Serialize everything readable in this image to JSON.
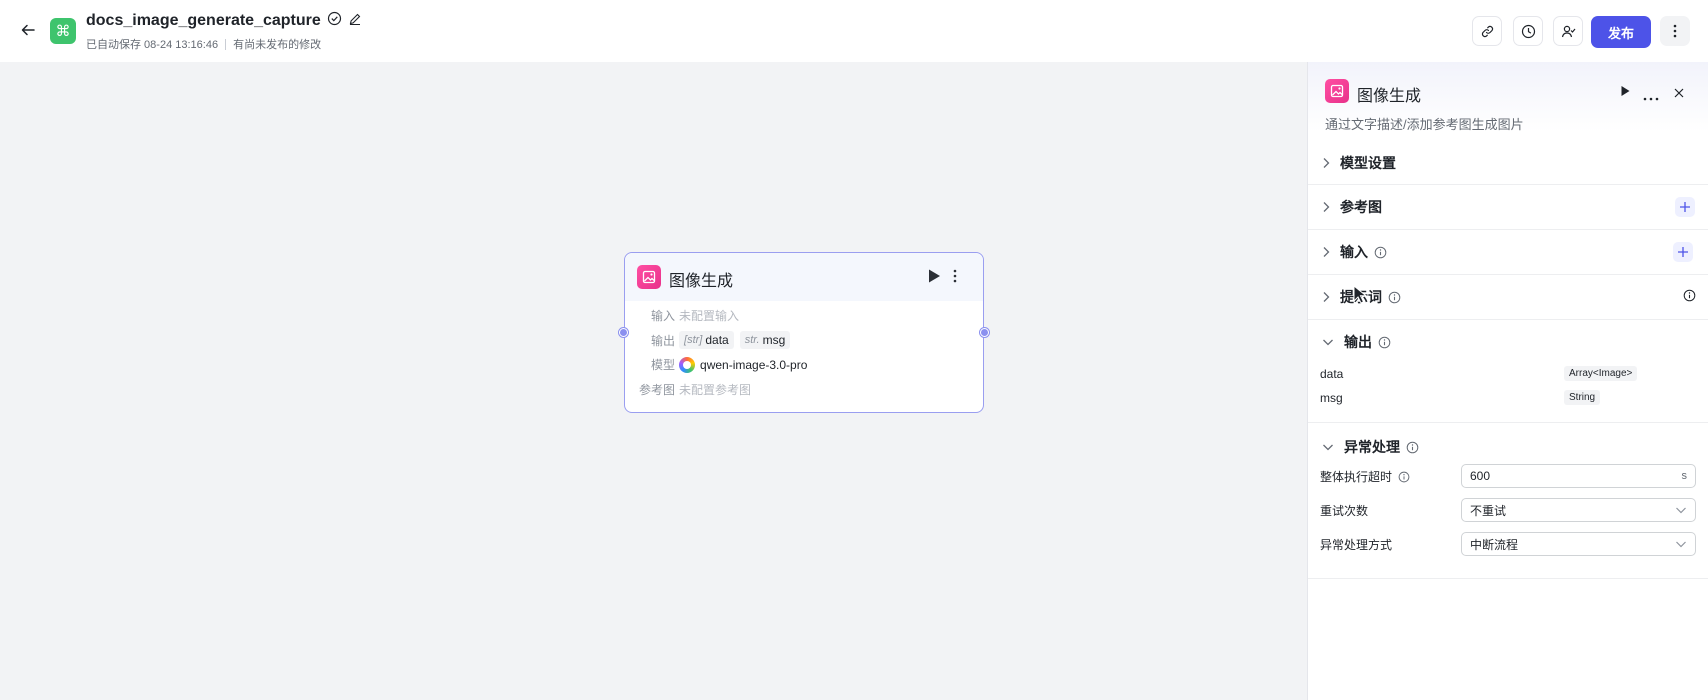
{
  "header": {
    "title": "docs_image_generate_capture",
    "autosave": "已自动保存 08-24 13:16:46",
    "unpublished": "有尚未发布的修改",
    "publish_label": "发布",
    "icons": [
      "back-arrow-icon",
      "app-command-icon",
      "check-circle-icon",
      "edit-pencil-icon",
      "link-icon",
      "history-clock-icon",
      "collaborator-icon",
      "more-vertical-icon"
    ]
  },
  "node": {
    "title": "图像生成",
    "input_label": "输入",
    "input_value": "未配置输入",
    "output_label": "输出",
    "outputs": [
      {
        "type": "[str]",
        "name": "data"
      },
      {
        "type": "str.",
        "name": "msg"
      }
    ],
    "model_label": "模型",
    "model_value": "qwen-image-3.0-pro",
    "ref_label": "参考图",
    "ref_value": "未配置参考图"
  },
  "panel": {
    "title": "图像生成",
    "description": "通过文字描述/添加参考图生成图片",
    "sections": {
      "model": "模型设置",
      "reference": "参考图",
      "input": "输入",
      "prompt": "提示词",
      "output": "输出",
      "exception": "异常处理"
    },
    "outputs": [
      {
        "name": "data",
        "type": "Array<Image>"
      },
      {
        "name": "msg",
        "type": "String"
      }
    ],
    "exception": {
      "timeout_label": "整体执行超时",
      "timeout_value": "600",
      "timeout_unit": "s",
      "retry_label": "重试次数",
      "retry_value": "不重试",
      "mode_label": "异常处理方式",
      "mode_value": "中断流程"
    }
  },
  "colors": {
    "primary": "#4d53e8",
    "app_icon": "#3ec46d",
    "node_icon": "#e8318a",
    "node_border": "#9a9ef0"
  }
}
